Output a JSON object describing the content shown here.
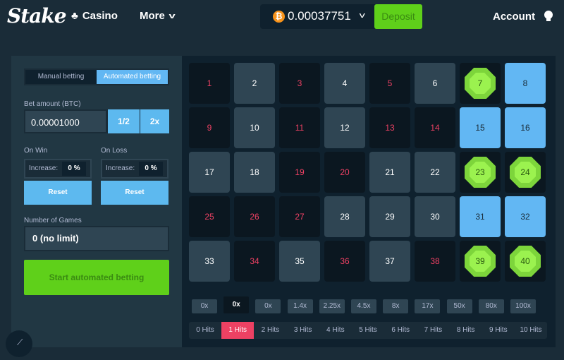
{
  "header": {
    "logo": "Stake",
    "nav": [
      {
        "label": "Casino"
      },
      {
        "label": "More"
      }
    ],
    "wallet": {
      "currency_symbol": "₿",
      "balance": "0.00037751",
      "deposit_label": "Deposit"
    },
    "account_label": "Account"
  },
  "controls": {
    "tabs": [
      "Manual betting",
      "Automated betting"
    ],
    "active_tab": "Automated betting",
    "bet_amount": {
      "label": "Bet amount (BTC)",
      "value": "0.00001000",
      "half_label": "1/2",
      "double_label": "2x"
    },
    "on_win": {
      "label": "On Win",
      "increase_label": "Increase:",
      "value": "0 %",
      "reset_label": "Reset"
    },
    "on_loss": {
      "label": "On Loss",
      "increase_label": "Increase:",
      "value": "0 %",
      "reset_label": "Reset"
    },
    "games": {
      "label": "Number of Games",
      "value": "0 (no limit)"
    },
    "start_label": "Start automated betting"
  },
  "board": {
    "tiles": [
      {
        "n": "1",
        "state": "picked"
      },
      {
        "n": "2",
        "state": "plain"
      },
      {
        "n": "3",
        "state": "picked"
      },
      {
        "n": "4",
        "state": "plain"
      },
      {
        "n": "5",
        "state": "picked"
      },
      {
        "n": "6",
        "state": "plain"
      },
      {
        "n": "7",
        "state": "gem"
      },
      {
        "n": "8",
        "state": "hit"
      },
      {
        "n": "9",
        "state": "picked"
      },
      {
        "n": "10",
        "state": "plain"
      },
      {
        "n": "11",
        "state": "picked"
      },
      {
        "n": "12",
        "state": "plain"
      },
      {
        "n": "13",
        "state": "picked"
      },
      {
        "n": "14",
        "state": "picked"
      },
      {
        "n": "15",
        "state": "hit"
      },
      {
        "n": "16",
        "state": "hit"
      },
      {
        "n": "17",
        "state": "plain"
      },
      {
        "n": "18",
        "state": "plain"
      },
      {
        "n": "19",
        "state": "picked"
      },
      {
        "n": "20",
        "state": "picked"
      },
      {
        "n": "21",
        "state": "plain"
      },
      {
        "n": "22",
        "state": "plain"
      },
      {
        "n": "23",
        "state": "gem"
      },
      {
        "n": "24",
        "state": "gem"
      },
      {
        "n": "25",
        "state": "picked"
      },
      {
        "n": "26",
        "state": "picked"
      },
      {
        "n": "27",
        "state": "picked"
      },
      {
        "n": "28",
        "state": "plain"
      },
      {
        "n": "29",
        "state": "plain"
      },
      {
        "n": "30",
        "state": "plain"
      },
      {
        "n": "31",
        "state": "hit"
      },
      {
        "n": "32",
        "state": "hit"
      },
      {
        "n": "33",
        "state": "plain"
      },
      {
        "n": "34",
        "state": "picked"
      },
      {
        "n": "35",
        "state": "plain"
      },
      {
        "n": "36",
        "state": "picked"
      },
      {
        "n": "37",
        "state": "plain"
      },
      {
        "n": "38",
        "state": "picked"
      },
      {
        "n": "39",
        "state": "gem"
      },
      {
        "n": "40",
        "state": "gem"
      }
    ],
    "payouts": [
      "0x",
      "0x",
      "0x",
      "1.4x",
      "2.25x",
      "4.5x",
      "8x",
      "17x",
      "50x",
      "80x",
      "100x"
    ],
    "active_payout_index": 1,
    "hits": [
      "0 Hits",
      "1 Hits",
      "2 Hits",
      "3 Hits",
      "4 Hits",
      "5 Hits",
      "6 Hits",
      "7 Hits",
      "8 Hits",
      "9 Hits",
      "10 Hits"
    ],
    "active_hits_index": 1
  }
}
